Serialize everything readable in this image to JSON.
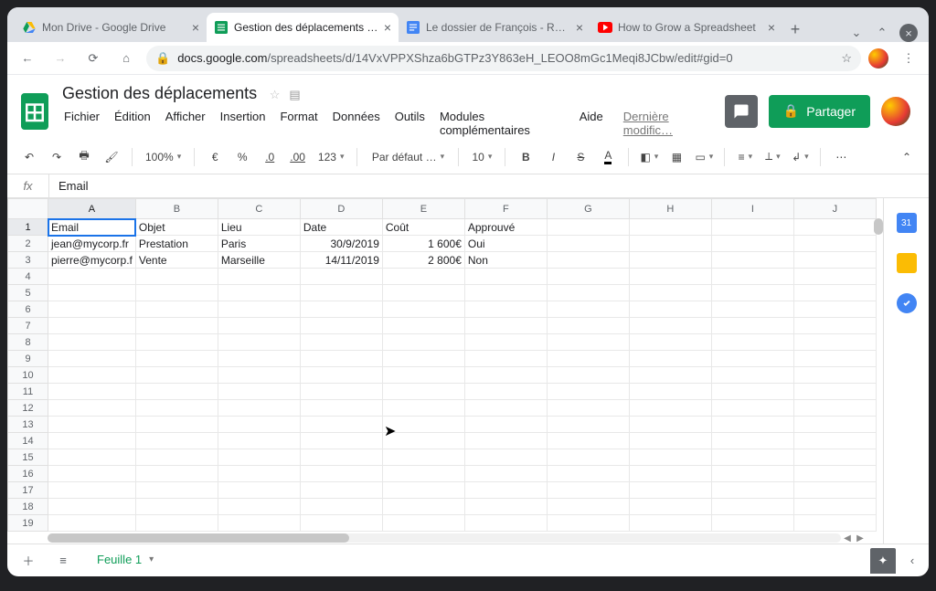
{
  "browser": {
    "tabs": [
      {
        "title": "Mon Drive - Google Drive",
        "icon": "drive"
      },
      {
        "title": "Gestion des déplacements - G",
        "icon": "sheets",
        "active": true
      },
      {
        "title": "Le dossier de François - Révé",
        "icon": "docs"
      },
      {
        "title": "How to Grow a Spreadsheet",
        "icon": "youtube"
      }
    ],
    "url_host": "docs.google.com",
    "url_path": "/spreadsheets/d/14VxVPPXShza6bGTPz3Y863eH_LEOO8mGc1Meqi8JCbw/edit#gid=0"
  },
  "doc": {
    "title": "Gestion des déplacements",
    "menus": [
      "Fichier",
      "Édition",
      "Afficher",
      "Insertion",
      "Format",
      "Données",
      "Outils",
      "Modules complémentaires",
      "Aide"
    ],
    "last_modified": "Dernière modific…",
    "share_label": "Partager"
  },
  "toolbar": {
    "zoom": "100%",
    "currency": "€",
    "percent": "%",
    "dec_dec": ".0",
    "inc_dec": ".00",
    "more_fmt": "123",
    "font": "Par défaut …",
    "font_size": "10"
  },
  "formula_bar": {
    "fx": "fx",
    "value": "Email"
  },
  "grid": {
    "columns": [
      "A",
      "B",
      "C",
      "D",
      "E",
      "F",
      "G",
      "H",
      "I",
      "J"
    ],
    "selected_cell": "A1",
    "headers": [
      "Email",
      "Objet",
      "Lieu",
      "Date",
      "Coût",
      "Approuvé"
    ],
    "rows": [
      {
        "email": "jean@mycorp.fr",
        "objet": "Prestation",
        "lieu": "Paris",
        "date": "30/9/2019",
        "cout": "1 600€",
        "approuve": "Oui"
      },
      {
        "email": "pierre@mycorp.f",
        "objet": "Vente",
        "lieu": "Marseille",
        "date": "14/11/2019",
        "cout": "2 800€",
        "approuve": "Non"
      }
    ],
    "blank_rows": 16
  },
  "sheet_tabs": {
    "active": "Feuille 1"
  }
}
